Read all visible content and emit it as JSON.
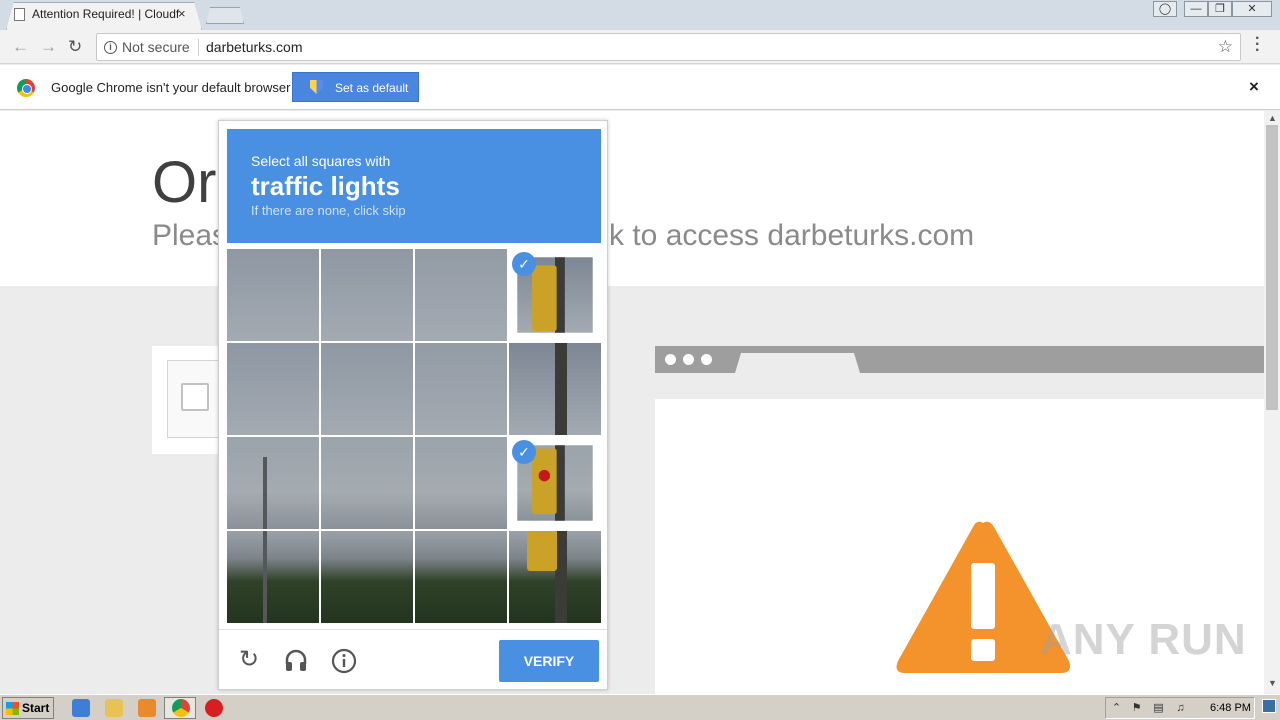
{
  "browser": {
    "tab_title": "Attention Required! | Cloudf",
    "tab_close": "×",
    "security_label": "Not secure",
    "url": "darbeturks.com"
  },
  "infobar": {
    "message": "Google Chrome isn't your default browser",
    "button_label": "Set as default",
    "close": "×"
  },
  "page": {
    "title_fragment": "Or",
    "subtitle_left": "Pleas",
    "subtitle_right": "k to access darbeturks.com"
  },
  "captcha": {
    "instruction_line1": "Select all squares with",
    "instruction_target": "traffic lights",
    "instruction_line3": "If there are none, click skip",
    "selected_cells": [
      3,
      11
    ],
    "verify_label": "VERIFY",
    "icons": [
      "reload-icon",
      "audio-icon",
      "info-icon"
    ]
  },
  "watermark": "ANY RUN",
  "taskbar": {
    "start_label": "Start",
    "clock": "6:48 PM"
  },
  "colors": {
    "captcha_blue": "#4a90e2",
    "warning_orange": "#f4922b",
    "set_default_blue": "#4a86e0"
  }
}
